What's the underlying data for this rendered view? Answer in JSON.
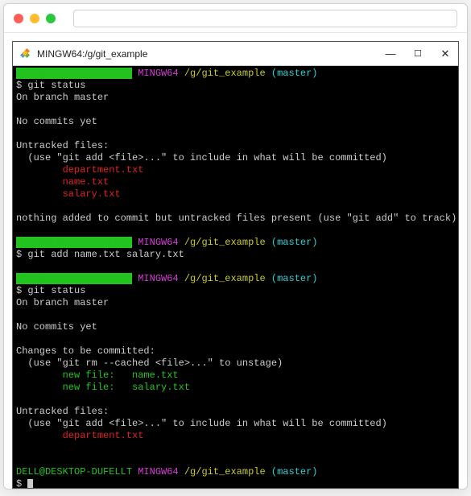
{
  "browser": {
    "url": ""
  },
  "window": {
    "title": "MINGW64:/g/git_example"
  },
  "prompt": {
    "user_host_obscured": "DELL@DESKTOP-DUFELLT",
    "shell": "MINGW64",
    "path": "/g/git_example",
    "branch": "(master)"
  },
  "commands": {
    "status1": "$ git status",
    "add": "$ git add name.txt salary.txt",
    "status2": "$ git status",
    "cursor": "$ "
  },
  "output": {
    "on_branch": "On branch master",
    "no_commits": "No commits yet",
    "untracked_header": "Untracked files:",
    "untracked_hint": "  (use \"git add <file>...\" to include in what will be committed)",
    "nothing_added": "nothing added to commit but untracked files present (use \"git add\" to track)",
    "staged_header": "Changes to be committed:",
    "staged_hint": "  (use \"git rm --cached <file>...\" to unstage)"
  },
  "files": {
    "untracked_all": {
      "f1": "        department.txt",
      "f2": "        name.txt",
      "f3": "        salary.txt"
    },
    "staged": {
      "f1": "        new file:   name.txt",
      "f2": "        new file:   salary.txt"
    },
    "untracked_remaining": {
      "f1": "        department.txt"
    }
  }
}
